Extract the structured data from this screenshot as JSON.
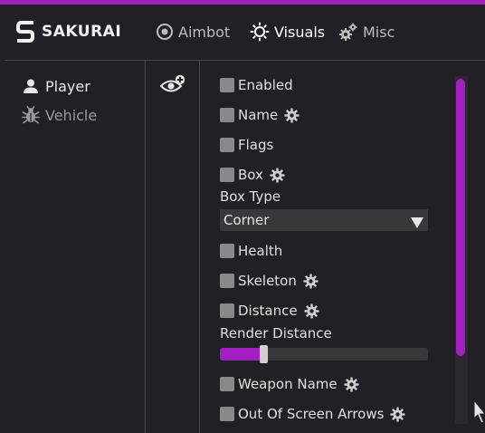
{
  "app": {
    "title": "SAKURAI"
  },
  "colors": {
    "accent": "#a21fc0",
    "background": "#221f26",
    "control": "#3a373d",
    "checkbox": "#8a878d"
  },
  "tabs": [
    {
      "label": "Aimbot",
      "icon": "target-icon",
      "active": false
    },
    {
      "label": "Visuals",
      "icon": "sun-icon",
      "active": true
    },
    {
      "label": "Misc",
      "icon": "gears-icon",
      "active": false
    }
  ],
  "sidebar": {
    "items": [
      {
        "label": "Player",
        "icon": "user-icon",
        "active": true
      },
      {
        "label": "Vehicle",
        "icon": "bug-icon",
        "active": false
      }
    ]
  },
  "subnav": {
    "icon": "eye-plus-icon"
  },
  "options": {
    "enabled": {
      "label": "Enabled",
      "checked": false
    },
    "name": {
      "label": "Name",
      "checked": false,
      "has_settings": true
    },
    "flags": {
      "label": "Flags",
      "checked": false
    },
    "box": {
      "label": "Box",
      "checked": false,
      "has_settings": true
    },
    "box_type": {
      "label": "Box Type",
      "value": "Corner"
    },
    "health": {
      "label": "Health",
      "checked": false
    },
    "skeleton": {
      "label": "Skeleton",
      "checked": false,
      "has_settings": true
    },
    "distance": {
      "label": "Distance",
      "checked": false,
      "has_settings": true
    },
    "render_distance": {
      "label": "Render Distance",
      "fraction": 0.21
    },
    "weapon_name": {
      "label": "Weapon Name",
      "checked": false,
      "has_settings": true
    },
    "out_of_screen_arrows": {
      "label": "Out Of Screen Arrows",
      "checked": false,
      "has_settings": true
    }
  },
  "scrollbar": {
    "position_fraction": 0.0,
    "visible_fraction": 0.8
  }
}
